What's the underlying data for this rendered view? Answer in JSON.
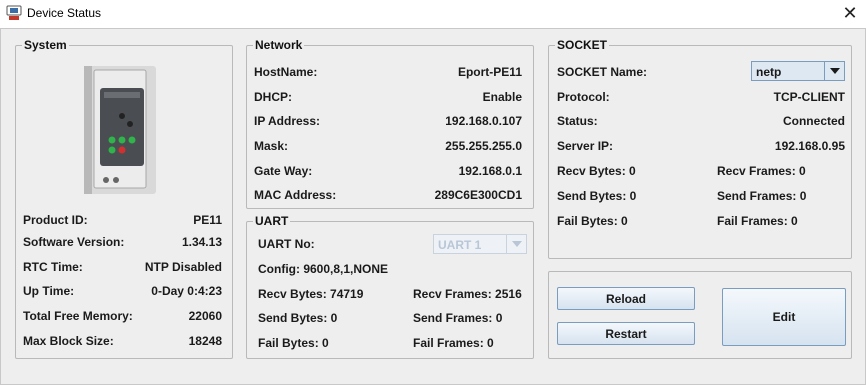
{
  "window": {
    "title": "Device Status",
    "close_glyph": "✕"
  },
  "system": {
    "title": "System",
    "rows": [
      {
        "label": "Product ID:",
        "value": "PE11"
      },
      {
        "label": "Software Version:",
        "value": "1.34.13"
      },
      {
        "label": "RTC Time:",
        "value": "NTP Disabled"
      },
      {
        "label": "Up Time:",
        "value": "0-Day 0:4:23"
      },
      {
        "label": "Total Free Memory:",
        "value": "22060"
      },
      {
        "label": "Max Block Size:",
        "value": "18248"
      }
    ]
  },
  "network": {
    "title": "Network",
    "rows": [
      {
        "label": "HostName:",
        "value": "Eport-PE11"
      },
      {
        "label": "DHCP:",
        "value": "Enable"
      },
      {
        "label": "IP Address:",
        "value": "192.168.0.107"
      },
      {
        "label": "Mask:",
        "value": "255.255.255.0"
      },
      {
        "label": "Gate Way:",
        "value": "192.168.0.1"
      },
      {
        "label": "MAC Address:",
        "value": "289C6E300CD1"
      }
    ]
  },
  "uart": {
    "title": "UART",
    "uart_no_label": "UART No:",
    "uart_no_value": "UART 1",
    "config": "Config: 9600,8,1,NONE",
    "recv_bytes": "Recv Bytes: 74719",
    "recv_frames": "Recv Frames: 2516",
    "send_bytes": "Send Bytes: 0",
    "send_frames": "Send Frames: 0",
    "fail_bytes": "Fail Bytes: 0",
    "fail_frames": "Fail Frames: 0"
  },
  "socket": {
    "title": "SOCKET",
    "name_label": "SOCKET Name:",
    "name_value": "netp",
    "protocol_label": "Protocol:",
    "protocol_value": "TCP-CLIENT",
    "status_label": "Status:",
    "status_value": "Connected",
    "server_ip_label": "Server IP:",
    "server_ip_value": "192.168.0.95",
    "recv_bytes": "Recv Bytes: 0",
    "recv_frames": "Recv Frames: 0",
    "send_bytes": "Send Bytes: 0",
    "send_frames": "Send Frames: 0",
    "fail_bytes": "Fail Bytes: 0",
    "fail_frames": "Fail Frames: 0"
  },
  "actions": {
    "reload": "Reload",
    "restart": "Restart",
    "edit": "Edit"
  },
  "colors": {
    "accent_border": "#7a9cbf",
    "panel_bg": "#eeeeee",
    "led_green": "#2fb34a",
    "led_red": "#d23030"
  }
}
